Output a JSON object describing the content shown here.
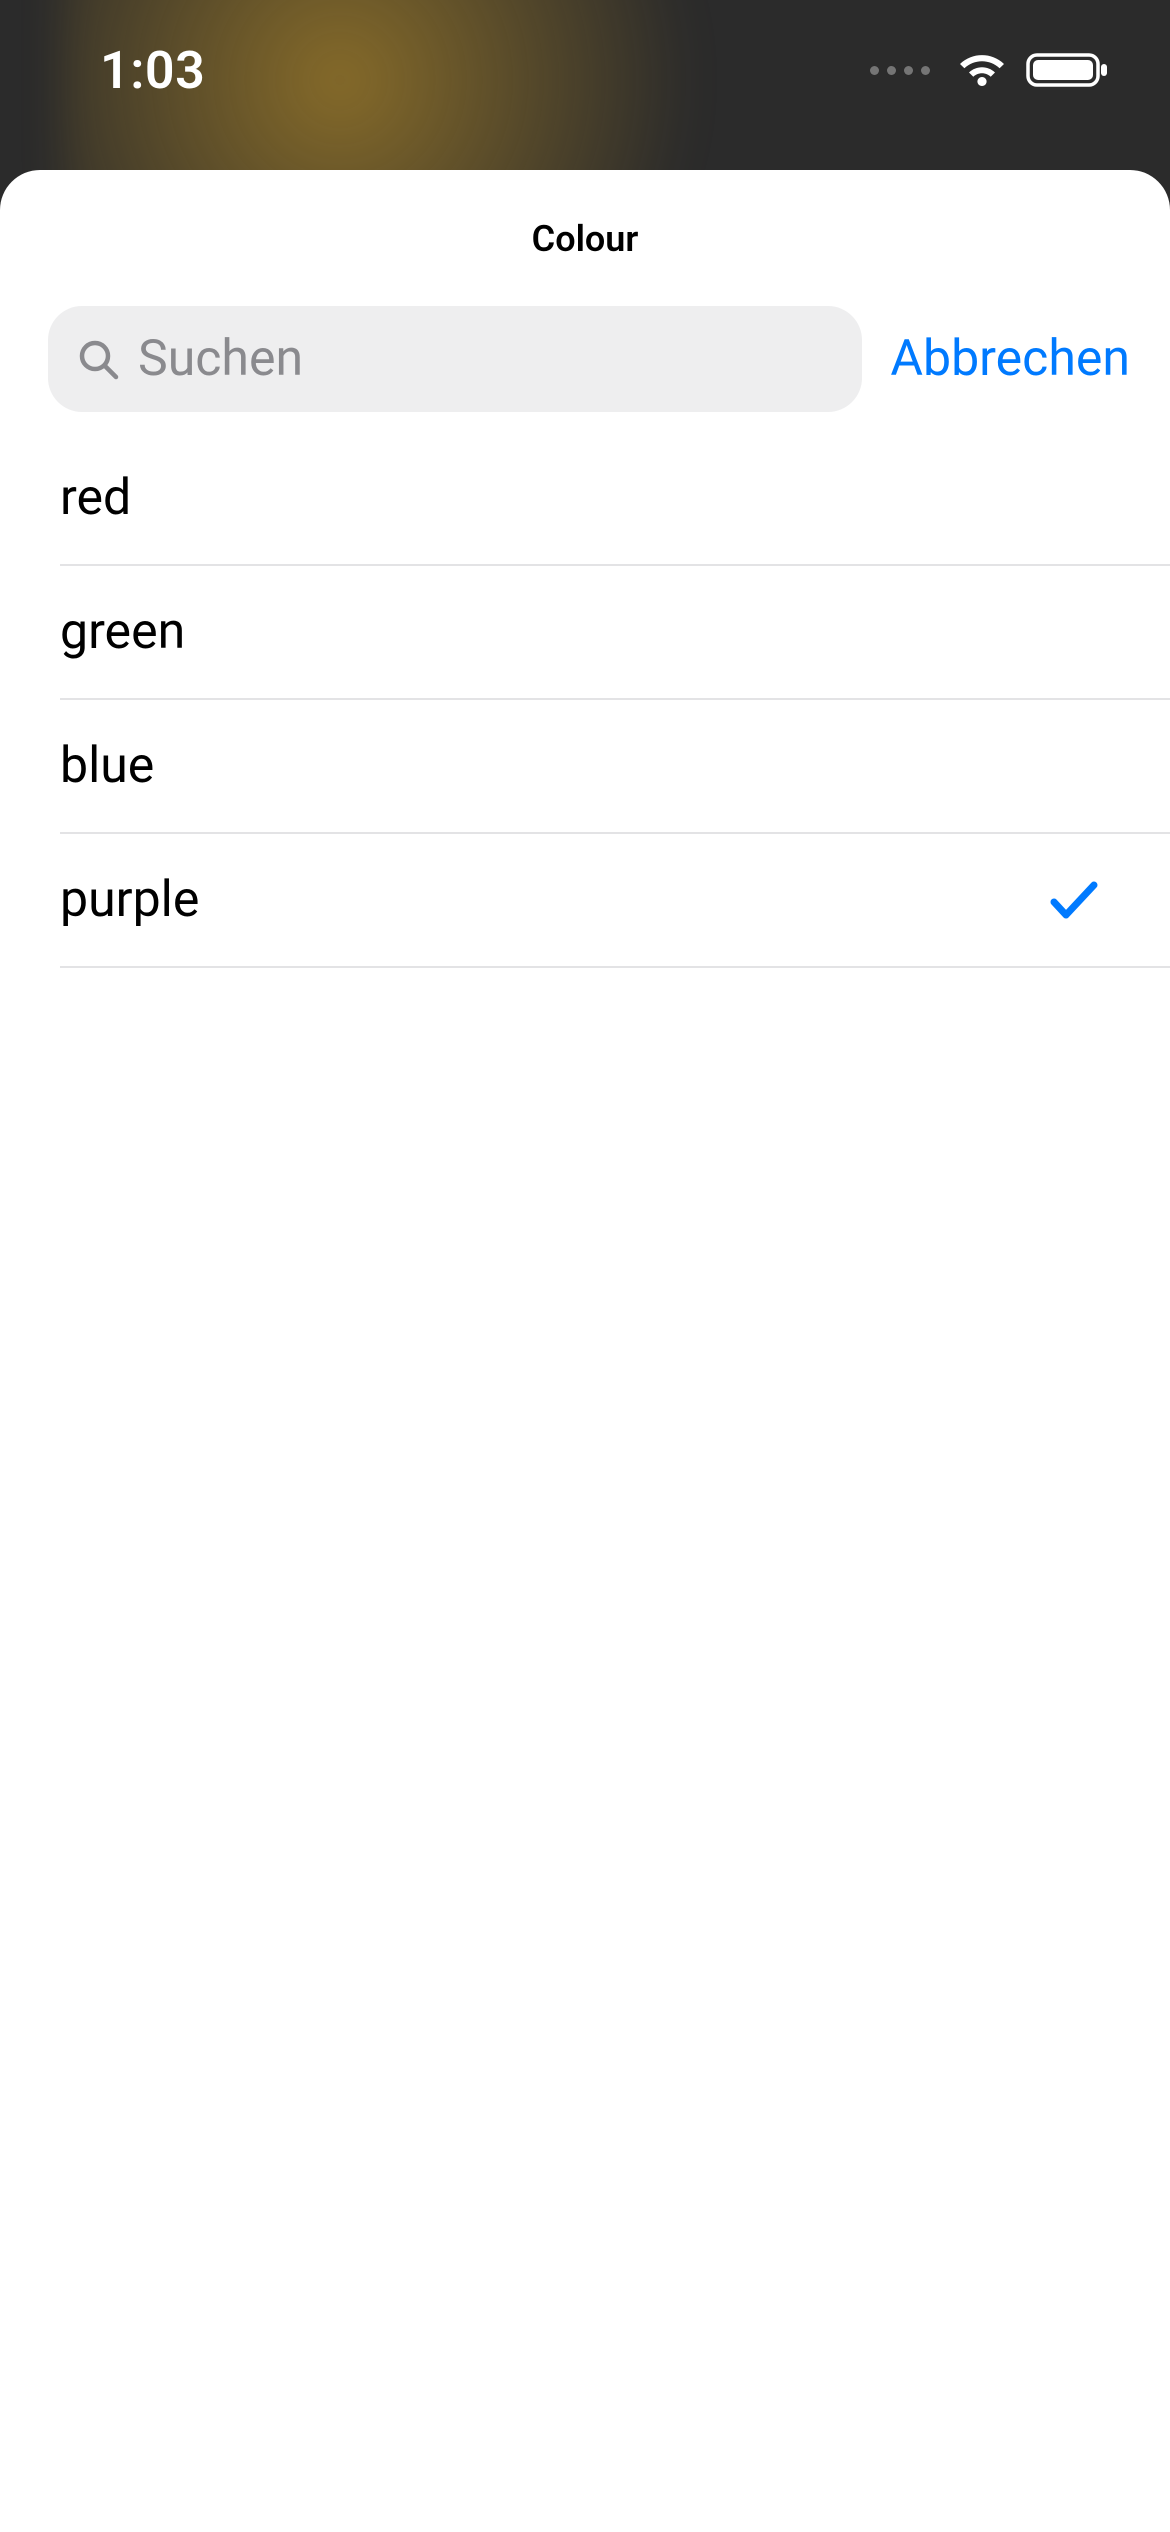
{
  "status": {
    "time": "1:03"
  },
  "sheet": {
    "title": "Colour"
  },
  "search": {
    "placeholder": "Suchen",
    "cancel": "Abbrechen"
  },
  "list": {
    "items": [
      {
        "label": "red",
        "selected": false
      },
      {
        "label": "green",
        "selected": false
      },
      {
        "label": "blue",
        "selected": false
      },
      {
        "label": "purple",
        "selected": true
      }
    ]
  },
  "colors": {
    "accent": "#007aff"
  }
}
